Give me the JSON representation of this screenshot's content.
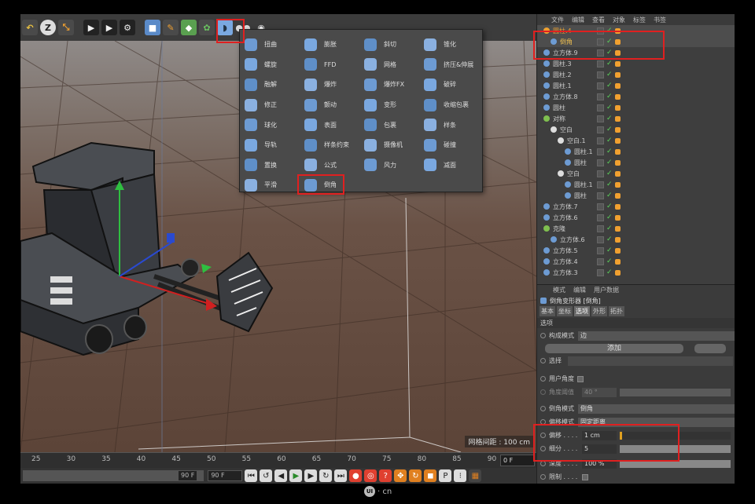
{
  "toolbar": {
    "icons": [
      "undo-icon",
      "z-icon",
      "transform-icon",
      "render-region-icon",
      "render-view-icon",
      "render-settings-icon",
      "cube-icon",
      "pen-icon",
      "subdivision-icon",
      "gear-generator-icon",
      "deformer-icon",
      "camera-icon",
      "light-icon"
    ],
    "z_label": "Z"
  },
  "deformer_menu": {
    "columns": [
      [
        "扭曲",
        "螺旋",
        "融解",
        "修正",
        "球化",
        "导轨",
        "置换",
        "平滑"
      ],
      [
        "膨胀",
        "FFD",
        "爆炸",
        "颤动",
        "表面",
        "样条约束",
        "公式",
        "倒角"
      ],
      [
        "斜切",
        "网格",
        "爆炸FX",
        "变形",
        "包裹",
        "摄像机",
        "风力"
      ],
      [
        "锥化",
        "挤压&伸展",
        "破碎",
        "收缩包裹",
        "样条",
        "碰撞",
        "减面"
      ]
    ],
    "highlighted_item": "倒角"
  },
  "viewport": {
    "grid_spacing": "网格间距 : 100 cm"
  },
  "timeline": {
    "ticks": [
      "25",
      "30",
      "35",
      "40",
      "45",
      "50",
      "55",
      "60",
      "65",
      "70",
      "75",
      "80",
      "85",
      "90"
    ],
    "frame": "0 F"
  },
  "controls": {
    "end_frame_a": "90 F",
    "end_frame_b": "90 F"
  },
  "object_manager": {
    "menu": [
      "文件",
      "编辑",
      "查看",
      "对象",
      "标签",
      "书签"
    ],
    "rows": [
      {
        "name": "圆柱.4",
        "indent": 0,
        "color": "#f0a030",
        "selected": true
      },
      {
        "name": "倒角",
        "indent": 1,
        "color": "#6d9bd3",
        "selected": true
      },
      {
        "name": "立方体.9",
        "indent": 0,
        "color": "#6d9bd3"
      },
      {
        "name": "圆柱.3",
        "indent": 0,
        "color": "#6d9bd3"
      },
      {
        "name": "圆柱.2",
        "indent": 0,
        "color": "#6d9bd3"
      },
      {
        "name": "圆柱.1",
        "indent": 0,
        "color": "#6d9bd3"
      },
      {
        "name": "立方体.8",
        "indent": 0,
        "color": "#6d9bd3"
      },
      {
        "name": "圆柱",
        "indent": 0,
        "color": "#6d9bd3"
      },
      {
        "name": "对称",
        "indent": 0,
        "color": "#7fbf4f"
      },
      {
        "name": "空白",
        "indent": 1,
        "color": "#dddddd"
      },
      {
        "name": "空白.1",
        "indent": 2,
        "color": "#dddddd"
      },
      {
        "name": "圆柱.1",
        "indent": 3,
        "color": "#6d9bd3"
      },
      {
        "name": "圆柱",
        "indent": 3,
        "color": "#6d9bd3"
      },
      {
        "name": "空白",
        "indent": 2,
        "color": "#dddddd"
      },
      {
        "name": "圆柱.1",
        "indent": 3,
        "color": "#6d9bd3"
      },
      {
        "name": "圆柱",
        "indent": 3,
        "color": "#6d9bd3"
      },
      {
        "name": "立方体.7",
        "indent": 0,
        "color": "#6d9bd3"
      },
      {
        "name": "立方体.6",
        "indent": 0,
        "color": "#6d9bd3"
      },
      {
        "name": "克隆",
        "indent": 0,
        "color": "#7fbf4f"
      },
      {
        "name": "立方体.6",
        "indent": 1,
        "color": "#6d9bd3"
      },
      {
        "name": "立方体.5",
        "indent": 0,
        "color": "#6d9bd3"
      },
      {
        "name": "立方体.4",
        "indent": 0,
        "color": "#6d9bd3"
      },
      {
        "name": "立方体.3",
        "indent": 0,
        "color": "#6d9bd3"
      }
    ]
  },
  "attributes": {
    "menu": [
      "模式",
      "编辑",
      "用户数据"
    ],
    "title": "倒角变形器 [倒角]",
    "tabs": [
      "基本",
      "坐标",
      "选项",
      "外形",
      "拓扑"
    ],
    "active_tab": "选项",
    "section": "选项",
    "build_mode_label": "构成模式",
    "build_mode_value": "边",
    "add_button": "添加",
    "selection_label": "选择",
    "user_angle_label": "用户角度",
    "angle_threshold_label": "角度阈值",
    "angle_threshold_value": "40 °",
    "bevel_mode_label": "倒角模式",
    "bevel_mode_value": "倒角",
    "offset_mode_label": "偏移模式",
    "offset_mode_value": "固定距离",
    "offset_label": "偏移 . . . .",
    "offset_value": "1 cm",
    "subdivision_label": "细分 . . . .",
    "subdivision_value": "5",
    "depth_label": "深度 . . . .",
    "depth_value": "100 %",
    "limit_label": "限制 . . . ."
  },
  "watermark": {
    "logo": "UI",
    "text": "· cn"
  }
}
